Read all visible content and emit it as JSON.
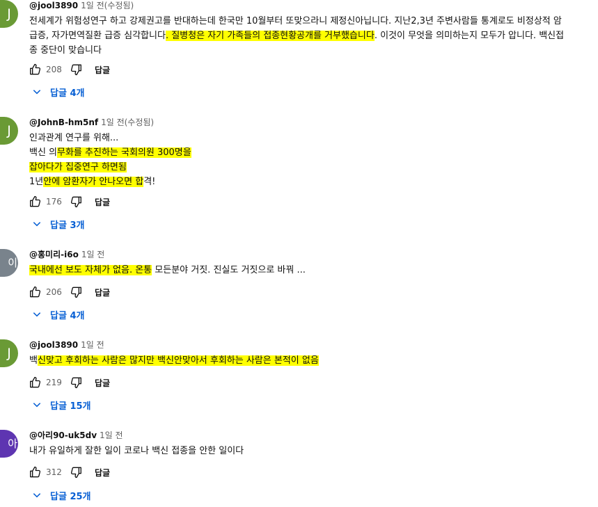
{
  "reply_label": "답글",
  "comments": [
    {
      "avatar_letter": "J",
      "avatar_color": "#6a9a35",
      "author": "@jool3890",
      "time": "1일 전(수정됨)",
      "lines": [
        [
          "전세계가 위험성연구 하고 강제권고를 반대하는데 한국만 10월부터 또맞으라니 제정신아닙니다. 지난2,3년 주변사람들 통계로도 비정상적 암"
        ],
        [
          "급증, 자가면역질환 급증 심각합니다",
          {
            "hl": ". 질병청은 자기 가족들의 접종현황공개를 거부했습니다"
          },
          ". 이것이 무엇을 의미하는지 모두가 압니다. 백신접"
        ],
        [
          "종 중단이 맞습니다"
        ]
      ],
      "likes": "208",
      "replies": "답글 4개"
    },
    {
      "avatar_letter": "J",
      "avatar_color": "#6a9a35",
      "author": "@JohnB-hm5nf",
      "time": "1일 전(수정됨)",
      "lines": [
        [
          "인과관계 연구를 위해..."
        ],
        [
          "백신 의",
          {
            "hl": "무화를 추진하는 국회의원 300명을  "
          }
        ],
        [
          {
            "hl": "잡아다가 집중연구 하면됨   "
          }
        ],
        [
          "1년",
          {
            "hl": "안에 암환자가 안나오면 합"
          },
          "격!"
        ]
      ],
      "likes": "176",
      "replies": "답글 3개"
    },
    {
      "avatar_letter": "이리",
      "avatar_color": "#79838c",
      "author": "@홍미리-i6o",
      "time": "1일 전",
      "lines": [
        [
          {
            "hl": "국내에선 보도 자체가 없음. 온통"
          },
          " 모든분야 거짓. 진실도 거짓으로 바꿔 ..."
        ]
      ],
      "likes": "206",
      "replies": "답글 4개"
    },
    {
      "avatar_letter": "J",
      "avatar_color": "#6a9a35",
      "author": "@jool3890",
      "time": "1일 전",
      "lines": [
        [
          "백",
          {
            "hl": "신맞고 후회하는 사람은 많지만 백신안맞아서 후회하는 사람은 본적이 없음 "
          }
        ]
      ],
      "likes": "219",
      "replies": "답글 15개"
    },
    {
      "avatar_letter": "아리",
      "avatar_color": "#5e35b1",
      "author": "@아리90-uk5dv",
      "time": "1일 전",
      "lines": [
        [
          "내가 유일하게 잘한 일이 코로나 백신 접종을 안한 일이다"
        ]
      ],
      "likes": "312",
      "replies": "답글 25개"
    }
  ]
}
